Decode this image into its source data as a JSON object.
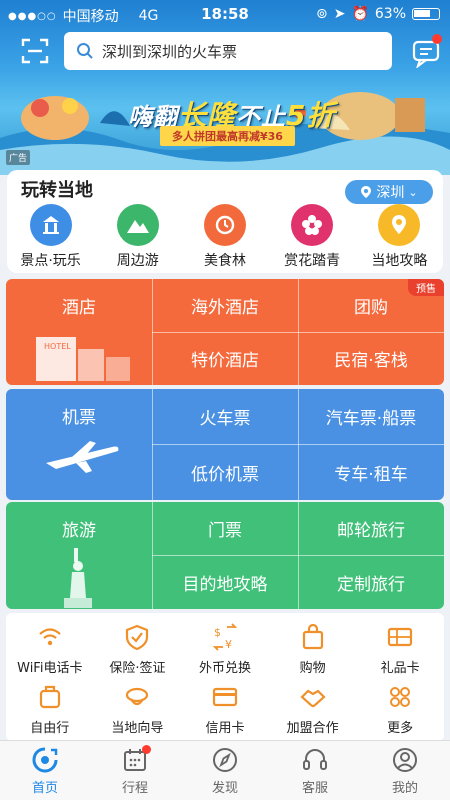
{
  "statusbar": {
    "carrier": "中国移动",
    "network": "4G",
    "time": "18:58",
    "battery": "63%"
  },
  "search": {
    "placeholder": "深圳到深圳的火车票",
    "scan_icon": "scan-icon",
    "message_icon": "message-icon"
  },
  "banner": {
    "title_pre": "嗨翻",
    "title_main": "长隆",
    "title_mid": "不止",
    "title_num": "5折",
    "subtitle": "多人拼团最高再减¥36",
    "ad_tag": "广告"
  },
  "local": {
    "title": "玩转当地",
    "city": "深圳",
    "items": [
      {
        "label": "景点·玩乐",
        "icon": "attraction-icon",
        "color": "#3f8ee6"
      },
      {
        "label": "周边游",
        "icon": "mountain-icon",
        "color": "#3cb66a"
      },
      {
        "label": "美食林",
        "icon": "food-icon",
        "color": "#f26a3c"
      },
      {
        "label": "赏花踏青",
        "icon": "flower-icon",
        "color": "#e0336d"
      },
      {
        "label": "当地攻略",
        "icon": "location-guide-icon",
        "color": "#f7b928"
      }
    ]
  },
  "hotel": {
    "title": "酒店",
    "cells": [
      "海外酒店",
      "团购",
      "特价酒店",
      "民宿·客栈"
    ],
    "badge": "预售",
    "color": "#f56a3d"
  },
  "flight": {
    "title": "机票",
    "cells": [
      "火车票",
      "汽车票·船票",
      "低价机票",
      "专车·租车"
    ],
    "color": "#4a91e3"
  },
  "travel": {
    "title": "旅游",
    "cells": [
      "门票",
      "邮轮旅行",
      "目的地攻略",
      "定制旅行"
    ],
    "color": "#41c07a"
  },
  "services": {
    "row1": [
      {
        "label": "WiFi电话卡",
        "icon": "wifi-icon"
      },
      {
        "label": "保险·签证",
        "icon": "shield-icon"
      },
      {
        "label": "外币兑换",
        "icon": "currency-exchange-icon"
      },
      {
        "label": "购物",
        "icon": "shopping-bag-icon"
      },
      {
        "label": "礼品卡",
        "icon": "gift-card-icon"
      }
    ],
    "row2": [
      {
        "label": "自由行",
        "icon": "suitcase-icon"
      },
      {
        "label": "当地向导",
        "icon": "guide-icon"
      },
      {
        "label": "信用卡",
        "icon": "credit-card-icon"
      },
      {
        "label": "加盟合作",
        "icon": "handshake-icon"
      },
      {
        "label": "更多",
        "icon": "more-icon"
      }
    ],
    "accent": "#f0902a"
  },
  "tabbar": [
    {
      "label": "首页",
      "icon": "home-icon",
      "active": true
    },
    {
      "label": "行程",
      "icon": "calendar-icon",
      "active": false
    },
    {
      "label": "发现",
      "icon": "compass-icon",
      "active": false
    },
    {
      "label": "客服",
      "icon": "headset-icon",
      "active": false
    },
    {
      "label": "我的",
      "icon": "user-icon",
      "active": false
    }
  ]
}
